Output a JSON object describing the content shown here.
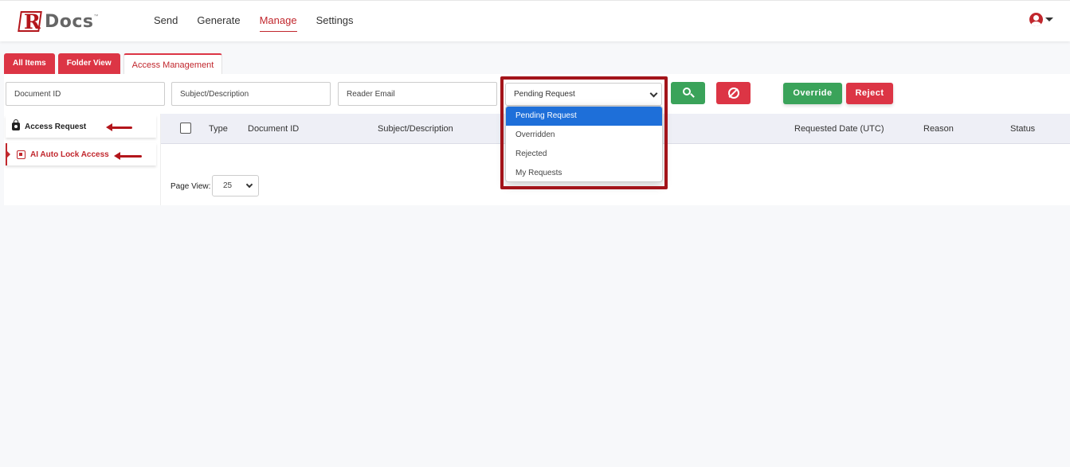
{
  "brand": {
    "logo_letter": "R",
    "logo_rest": "Docs",
    "logo_tm": "™"
  },
  "nav": {
    "items": [
      {
        "label": "Send"
      },
      {
        "label": "Generate"
      },
      {
        "label": "Manage"
      },
      {
        "label": "Settings"
      }
    ],
    "active": "Manage"
  },
  "tabs": [
    {
      "label": "All Items"
    },
    {
      "label": "Folder View"
    },
    {
      "label": "Access Management"
    }
  ],
  "filters": {
    "document_id_placeholder": "Document ID",
    "subject_placeholder": "Subject/Description",
    "reader_email_placeholder": "Reader Email",
    "status_selected": "Pending Request",
    "status_options": [
      "Pending Request",
      "Overridden",
      "Rejected",
      "My Requests"
    ]
  },
  "actions": {
    "override_label": "Override",
    "reject_label": "Reject"
  },
  "side_menu": [
    {
      "label": "Access Request",
      "icon": "lock-icon"
    },
    {
      "label": "AI Auto Lock Access",
      "icon": "ai-icon"
    }
  ],
  "table": {
    "columns": [
      "Type",
      "Document ID",
      "Subject/Description",
      "Requested Date (UTC)",
      "Reason",
      "Status"
    ],
    "rows": []
  },
  "pagination": {
    "label": "Page View:",
    "value": "25"
  },
  "colors": {
    "brand_red": "#c1272d",
    "green": "#3aa35a",
    "highlight": "#a3141a",
    "selected_blue": "#1e6fd9"
  }
}
